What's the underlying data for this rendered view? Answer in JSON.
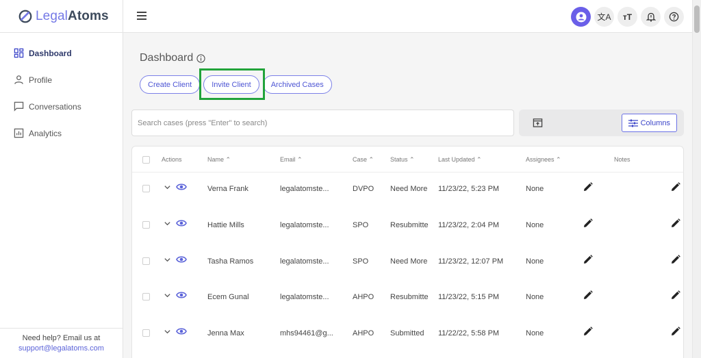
{
  "app": {
    "logo_legal": "Legal",
    "logo_atoms": "Atoms"
  },
  "sidebar": {
    "items": [
      {
        "label": "Dashboard",
        "icon": "dashboard-icon",
        "active": true
      },
      {
        "label": "Profile",
        "icon": "person-icon"
      },
      {
        "label": "Conversations",
        "icon": "chat-icon"
      },
      {
        "label": "Analytics",
        "icon": "analytics-icon"
      }
    ],
    "help_text": "Need help? Email us at",
    "help_email": "support@legalatoms.com"
  },
  "header": {
    "icons": [
      "account-icon",
      "translate-icon",
      "text-size-icon",
      "notification-icon",
      "help-icon"
    ],
    "translate_glyph": "文A",
    "text_size_glyph": "тT"
  },
  "main": {
    "title": "Dashboard",
    "buttons": {
      "create": "Create Client",
      "invite": "Invite Client",
      "archived": "Archived Cases"
    },
    "search_placeholder": "Search cases (press \"Enter\" to search)",
    "columns_label": "Columns"
  },
  "table": {
    "headers": {
      "actions": "Actions",
      "name": "Name ⌃",
      "email": "Email ⌃",
      "case": "Case ⌃",
      "status": "Status ⌃",
      "updated": "Last Updated ⌃",
      "assignees": "Assignees ⌃",
      "notes": "Notes"
    },
    "rows": [
      {
        "name": "Verna Frank",
        "email": "legalatomste...",
        "case": "DVPO",
        "status": "Need More",
        "updated": "11/23/22, 5:23 PM",
        "assignees": "None"
      },
      {
        "name": "Hattie Mills",
        "email": "legalatomste...",
        "case": "SPO",
        "status": "Resubmitte",
        "updated": "11/23/22, 2:04 PM",
        "assignees": "None"
      },
      {
        "name": "Tasha Ramos",
        "email": "legalatomste...",
        "case": "SPO",
        "status": "Need More",
        "updated": "11/23/22, 12:07 PM",
        "assignees": "None"
      },
      {
        "name": "Ecem Gunal",
        "email": "legalatomste...",
        "case": "AHPO",
        "status": "Resubmitte",
        "updated": "11/23/22, 5:15 PM",
        "assignees": "None"
      },
      {
        "name": "Jenna Max",
        "email": "mhs94461@g...",
        "case": "AHPO",
        "status": "Submitted",
        "updated": "11/22/22, 5:58 PM",
        "assignees": "None"
      }
    ]
  },
  "colors": {
    "accent": "#6a5fe8",
    "highlight": "#21a33a"
  }
}
